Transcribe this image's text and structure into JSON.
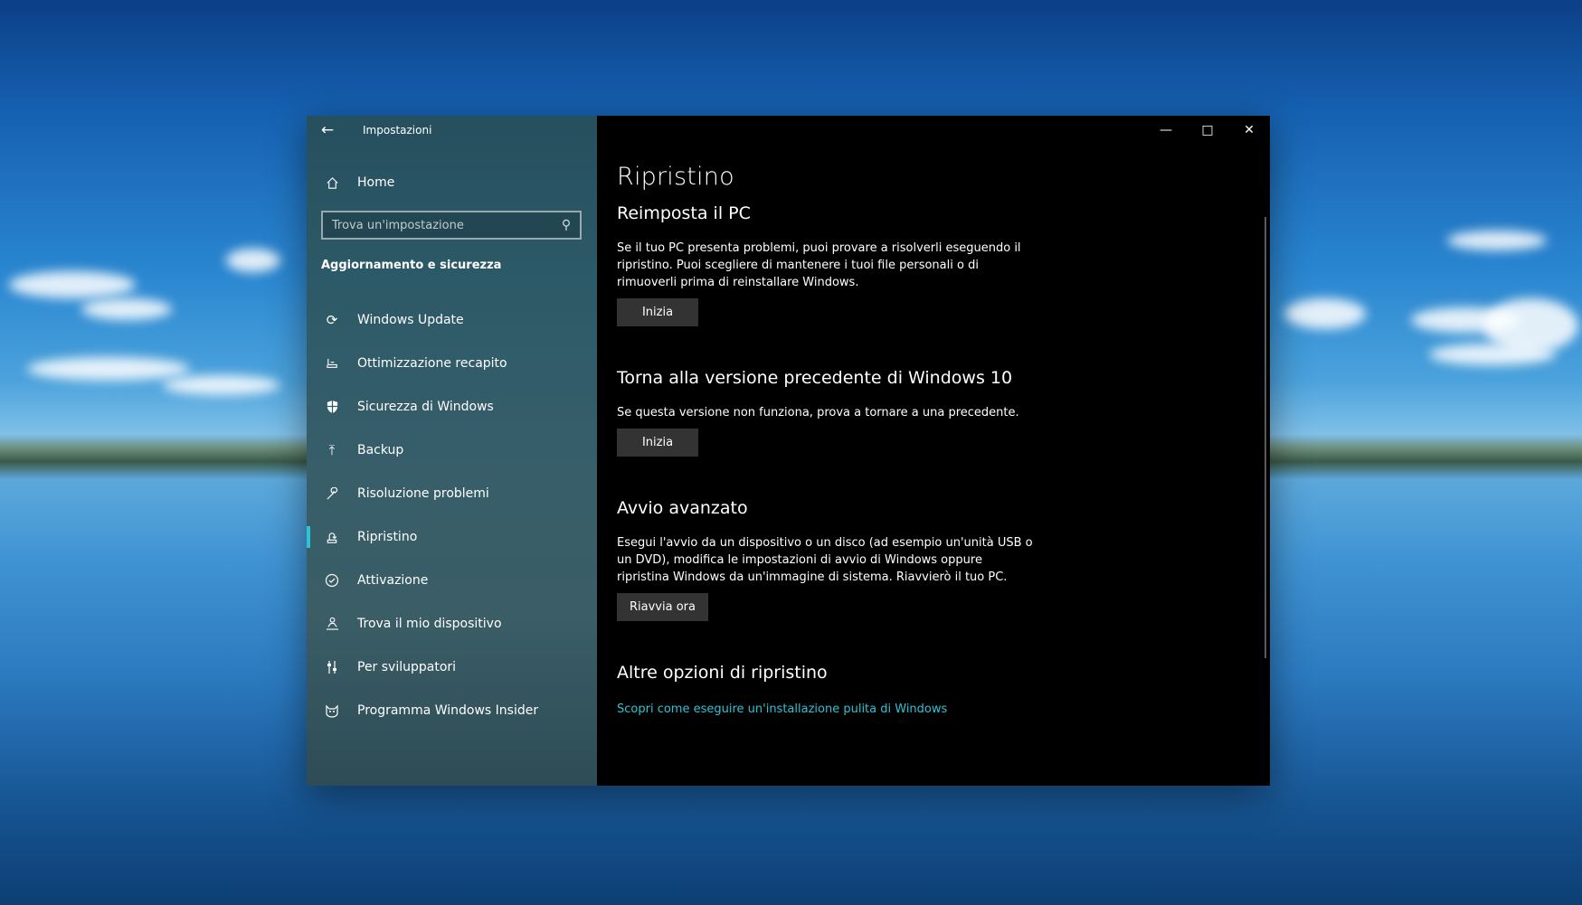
{
  "window": {
    "app_title": "Impostazioni"
  },
  "sidebar": {
    "home_label": "Home",
    "search_placeholder": "Trova un'impostazione",
    "section_title": "Aggiornamento e sicurezza",
    "items": [
      {
        "label": "Windows Update",
        "icon": "refresh-icon"
      },
      {
        "label": "Ottimizzazione recapito",
        "icon": "delivery-icon"
      },
      {
        "label": "Sicurezza di Windows",
        "icon": "shield-icon"
      },
      {
        "label": "Backup",
        "icon": "upload-arrow-icon"
      },
      {
        "label": "Risoluzione problemi",
        "icon": "wrench-icon"
      },
      {
        "label": "Ripristino",
        "icon": "recovery-icon",
        "active": true
      },
      {
        "label": "Attivazione",
        "icon": "check-circle-icon"
      },
      {
        "label": "Trova il mio dispositivo",
        "icon": "person-location-icon"
      },
      {
        "label": "Per sviluppatori",
        "icon": "sliders-icon"
      },
      {
        "label": "Programma Windows Insider",
        "icon": "insider-cat-icon"
      }
    ]
  },
  "main": {
    "page_title": "Ripristino",
    "sections": [
      {
        "heading": "Reimposta il PC",
        "text": "Se il tuo PC presenta problemi, puoi provare a risolverli eseguendo il ripristino. Puoi scegliere di mantenere i tuoi file personali o di rimuoverli prima di reinstallare Windows.",
        "button": "Inizia"
      },
      {
        "heading": "Torna alla versione precedente di Windows 10",
        "text": "Se questa versione non funziona, prova a tornare a una precedente.",
        "button": "Inizia"
      },
      {
        "heading": "Avvio avanzato",
        "text": "Esegui l'avvio da un dispositivo o un disco (ad esempio un'unità USB o un DVD), modifica le impostazioni di avvio di Windows oppure ripristina Windows da un'immagine di sistema. Riavvierò il tuo PC.",
        "button": "Riavvia ora"
      },
      {
        "heading": "Altre opzioni di ripristino",
        "link": "Scopri come eseguire un'installazione pulita di Windows"
      }
    ]
  },
  "colors": {
    "accent": "#2ec3d4",
    "content_bg": "#000000",
    "button_bg": "#333333"
  }
}
